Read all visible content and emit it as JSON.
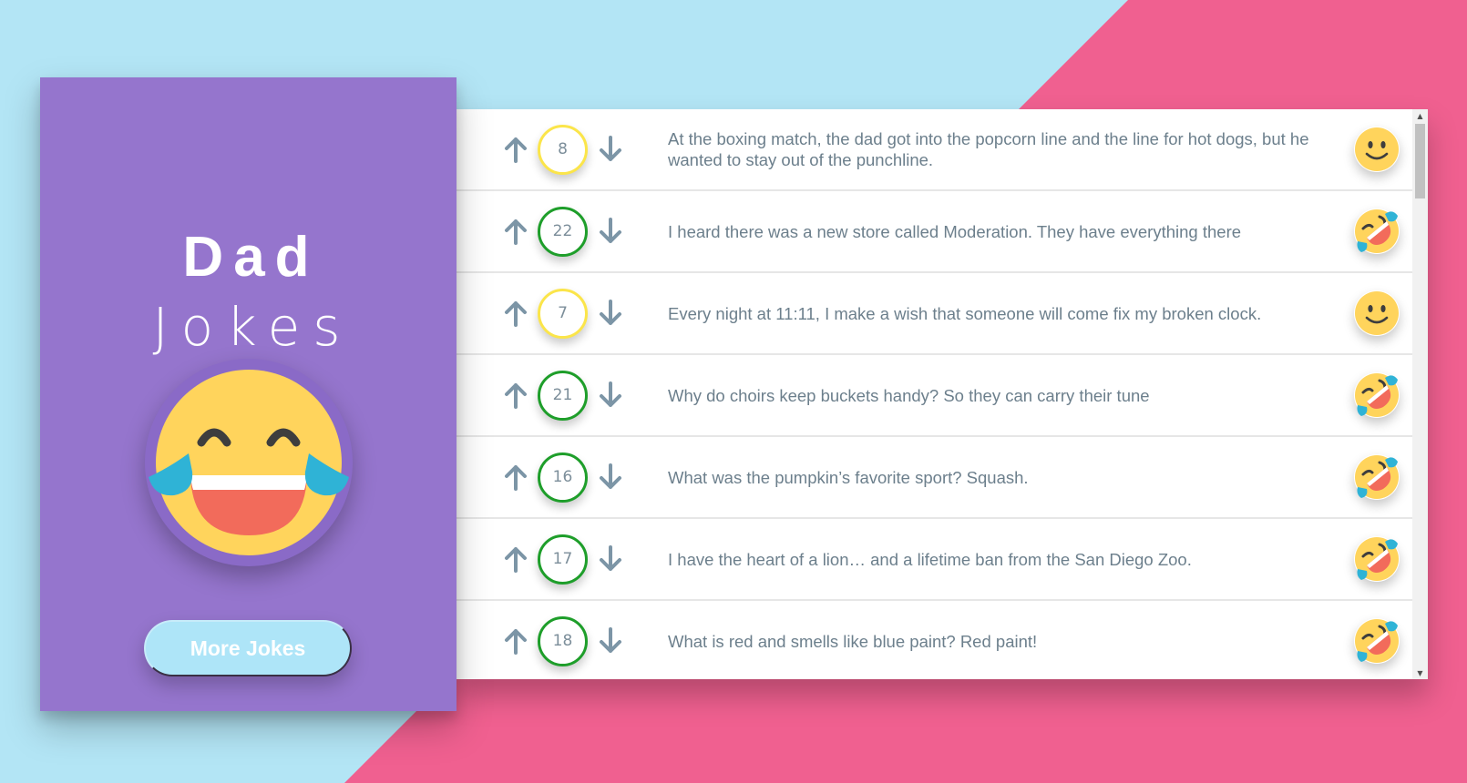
{
  "app": {
    "title_line1": "Dad",
    "title_line2": "Jokes",
    "more_button_label": "More Jokes",
    "hero_emoji": "laughing-tears-icon"
  },
  "colors": {
    "background_blue": "#b3e5f5",
    "background_pink": "#f06090",
    "sidebar_purple": "#9575cd",
    "score_green": "#1e9e2a",
    "score_yellow": "#fbe54a"
  },
  "jokes": [
    {
      "score": "8",
      "level": "yellow",
      "emoji": "slight-smile-icon",
      "text": "At the boxing match, the dad got into the popcorn line and the line for hot dogs, but he wanted to stay out of the punchline."
    },
    {
      "score": "22",
      "level": "green",
      "emoji": "rofl-icon",
      "text": "I heard there was a new store called Moderation. They have everything there"
    },
    {
      "score": "7",
      "level": "yellow",
      "emoji": "slight-smile-icon",
      "text": "Every night at 11:11, I make a wish that someone will come fix my broken clock."
    },
    {
      "score": "21",
      "level": "green",
      "emoji": "rofl-icon",
      "text": "Why do choirs keep buckets handy? So they can carry their tune"
    },
    {
      "score": "16",
      "level": "green",
      "emoji": "rofl-icon",
      "text": "What was the pumpkin’s favorite sport? Squash."
    },
    {
      "score": "17",
      "level": "green",
      "emoji": "rofl-icon",
      "text": "I have the heart of a lion… and a lifetime ban from the San Diego Zoo."
    },
    {
      "score": "18",
      "level": "green",
      "emoji": "rofl-icon",
      "text": "What is red and smells like blue paint? Red paint!"
    }
  ]
}
